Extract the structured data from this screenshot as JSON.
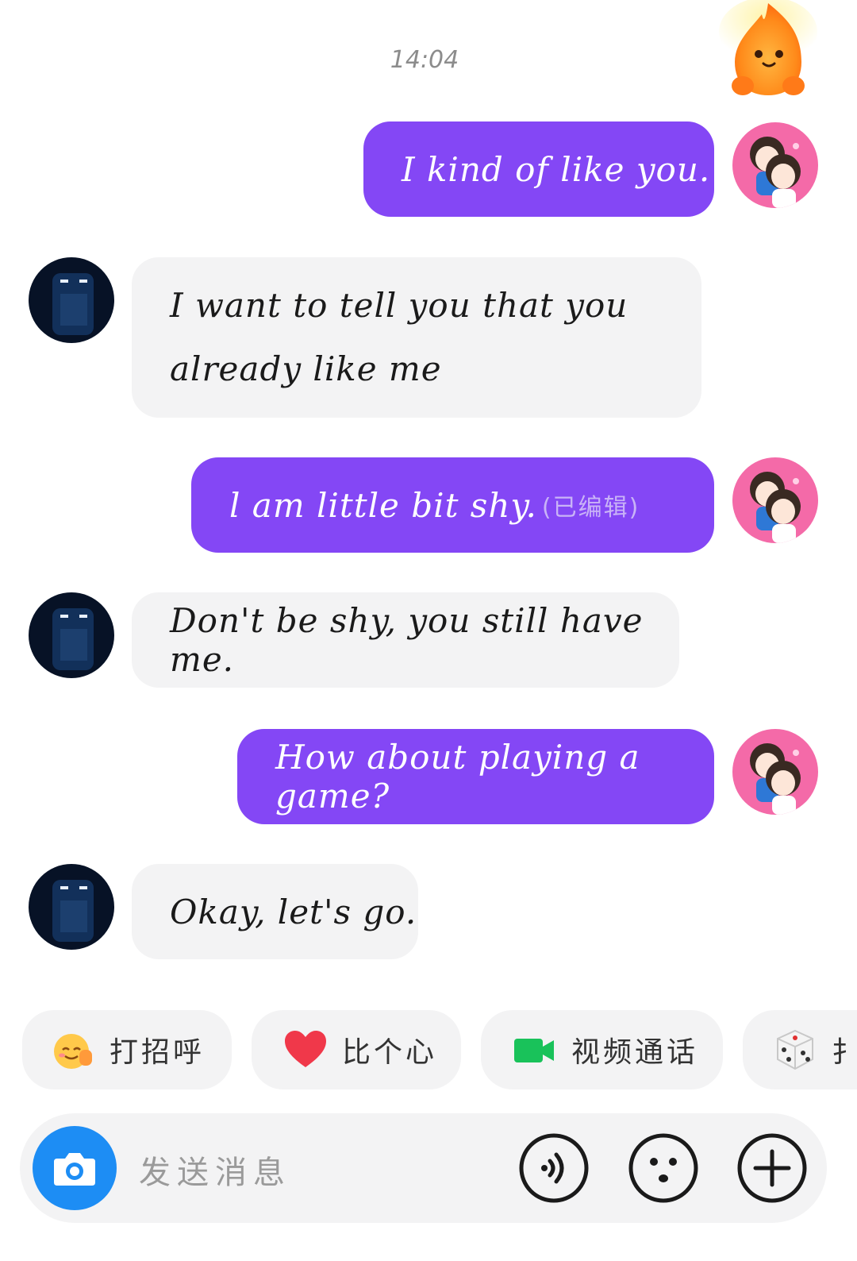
{
  "timestamp": "14:04",
  "messages": [
    {
      "side": "out",
      "text": "I kind of like you.",
      "edited": ""
    },
    {
      "side": "in",
      "text": "I want to tell you that you",
      "text2": "already like me"
    },
    {
      "side": "out",
      "text": "l am little bit shy.",
      "edited": "(已编辑)"
    },
    {
      "side": "in",
      "text": "Don't be shy, you still have me."
    },
    {
      "side": "out",
      "text": "How about playing a game?"
    },
    {
      "side": "in",
      "text": "Okay, let's go."
    }
  ],
  "quick_actions": [
    {
      "label": "打招呼",
      "icon": "waving-emoji-icon"
    },
    {
      "label": "比个心",
      "icon": "heart-icon"
    },
    {
      "label": "视频通话",
      "icon": "video-camera-icon"
    },
    {
      "label": "扌",
      "icon": "dice-icon"
    }
  ],
  "input": {
    "placeholder": "发送消息"
  },
  "colors": {
    "outgoing_bubble": "#8447f5",
    "incoming_bubble": "#f3f3f4",
    "camera_button": "#1d8df4"
  }
}
